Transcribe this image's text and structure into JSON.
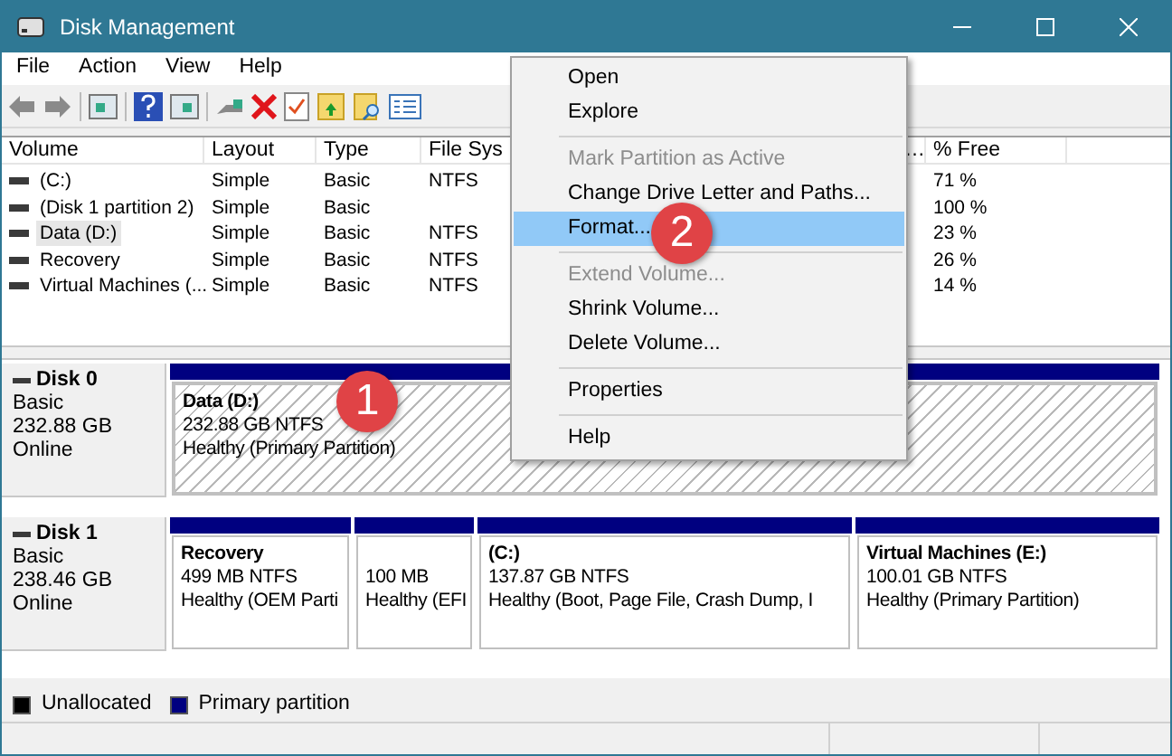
{
  "window": {
    "title": "Disk Management"
  },
  "menu_bar": [
    "File",
    "Action",
    "View",
    "Help"
  ],
  "volume_table": {
    "columns": [
      "Volume",
      "Layout",
      "Type",
      "File Sys",
      "…",
      "% Free"
    ],
    "rows": [
      {
        "volume": "(C:)",
        "layout": "Simple",
        "type": "Basic",
        "file_system": "NTFS",
        "free": "71 %",
        "selected": false
      },
      {
        "volume": "(Disk 1 partition 2)",
        "layout": "Simple",
        "type": "Basic",
        "free": "100 %",
        "selected": false
      },
      {
        "volume": "Data (D:)",
        "layout": "Simple",
        "type": "Basic",
        "file_system": "NTFS",
        "free": "23 %",
        "selected": true
      },
      {
        "volume": "Recovery",
        "layout": "Simple",
        "type": "Basic",
        "file_system": "NTFS",
        "free": "26 %",
        "selected": false
      },
      {
        "volume": "Virtual Machines (...",
        "layout": "Simple",
        "type": "Basic",
        "file_system": "NTFS",
        "free": "14 %",
        "selected": false
      }
    ]
  },
  "disks": [
    {
      "name": "Disk 0",
      "type": "Basic",
      "size": "232.88 GB",
      "status": "Online",
      "partitions": [
        {
          "label": "Data  (D:)",
          "size": "232.88 GB NTFS",
          "status": "Healthy (Primary Partition)",
          "selected": true
        }
      ]
    },
    {
      "name": "Disk 1",
      "type": "Basic",
      "size": "238.46 GB",
      "status": "Online",
      "partitions": [
        {
          "label": "Recovery",
          "size": "499 MB NTFS",
          "status": "Healthy (OEM Parti",
          "selected": false
        },
        {
          "size": "100 MB",
          "status": "Healthy (EFI",
          "selected": false
        },
        {
          "label": "(C:)",
          "size": "137.87 GB NTFS",
          "status": "Healthy (Boot, Page File, Crash Dump, I",
          "selected": false
        },
        {
          "label": "Virtual Machines  (E:)",
          "size": "100.01 GB NTFS",
          "status": "Healthy (Primary Partition)",
          "selected": false
        }
      ]
    }
  ],
  "legend": [
    {
      "label": "Unallocated",
      "color": "#000000"
    },
    {
      "label": "Primary partition",
      "color": "#000080"
    }
  ],
  "context_menu": [
    {
      "kind": "item",
      "label": "Open",
      "disabled": false,
      "selected": false
    },
    {
      "kind": "item",
      "label": "Explore",
      "disabled": false,
      "selected": false
    },
    {
      "kind": "separator"
    },
    {
      "kind": "item",
      "label": "Mark Partition as Active",
      "disabled": true,
      "selected": false
    },
    {
      "kind": "item",
      "label": "Change Drive Letter and Paths...",
      "disabled": false,
      "selected": false
    },
    {
      "kind": "item",
      "label": "Format...",
      "disabled": false,
      "selected": true
    },
    {
      "kind": "separator"
    },
    {
      "kind": "item",
      "label": "Extend Volume...",
      "disabled": true,
      "selected": false
    },
    {
      "kind": "item",
      "label": "Shrink Volume...",
      "disabled": false,
      "selected": false
    },
    {
      "kind": "item",
      "label": "Delete Volume...",
      "disabled": false,
      "selected": false
    },
    {
      "kind": "separator"
    },
    {
      "kind": "item",
      "label": "Properties",
      "disabled": false,
      "selected": false
    },
    {
      "kind": "separator"
    },
    {
      "kind": "item",
      "label": "Help",
      "disabled": false,
      "selected": false
    }
  ],
  "annotations": [
    {
      "number": "1"
    },
    {
      "number": "2"
    }
  ]
}
